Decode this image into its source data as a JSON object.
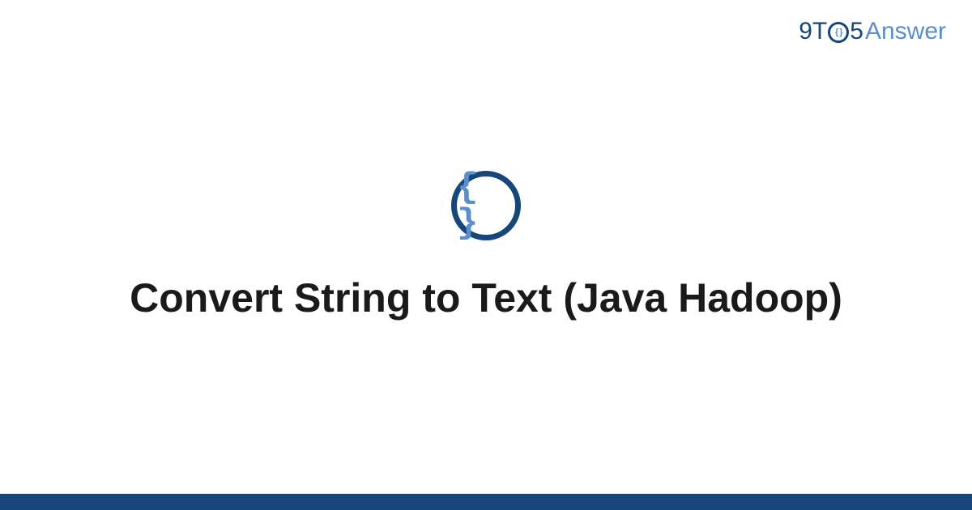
{
  "logo": {
    "part1": "9T",
    "circle_inner": "{ }",
    "part2": "5",
    "part3": "Answer"
  },
  "icon": {
    "glyph": "{ }"
  },
  "title": "Convert String to Text (Java Hadoop)",
  "colors": {
    "dark_blue": "#17467a",
    "light_blue": "#5a8fc9"
  }
}
